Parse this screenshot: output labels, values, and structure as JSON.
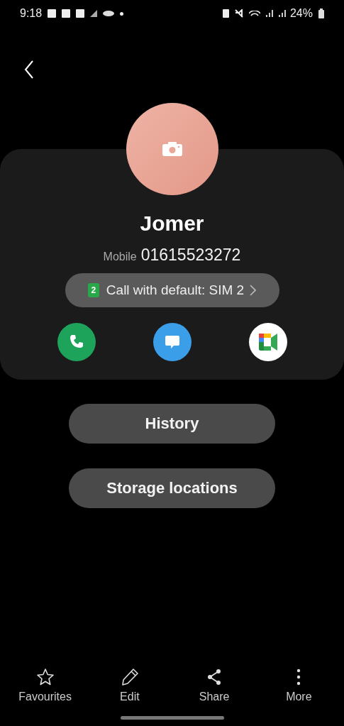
{
  "status_bar": {
    "time": "9:18",
    "battery": "24%"
  },
  "contact": {
    "name": "Jomer",
    "number_label": "Mobile",
    "number": "01615523272",
    "sim_badge": "2",
    "sim_text": "Call with default: SIM 2"
  },
  "actions": [
    {
      "kind": "call"
    },
    {
      "kind": "message"
    },
    {
      "kind": "video"
    }
  ],
  "buttons": [
    "History",
    "Storage locations"
  ],
  "bottom_nav": [
    {
      "kind": "star",
      "label": "Favourites"
    },
    {
      "kind": "edit",
      "label": "Edit"
    },
    {
      "kind": "share",
      "label": "Share"
    },
    {
      "kind": "more",
      "label": "More"
    }
  ]
}
